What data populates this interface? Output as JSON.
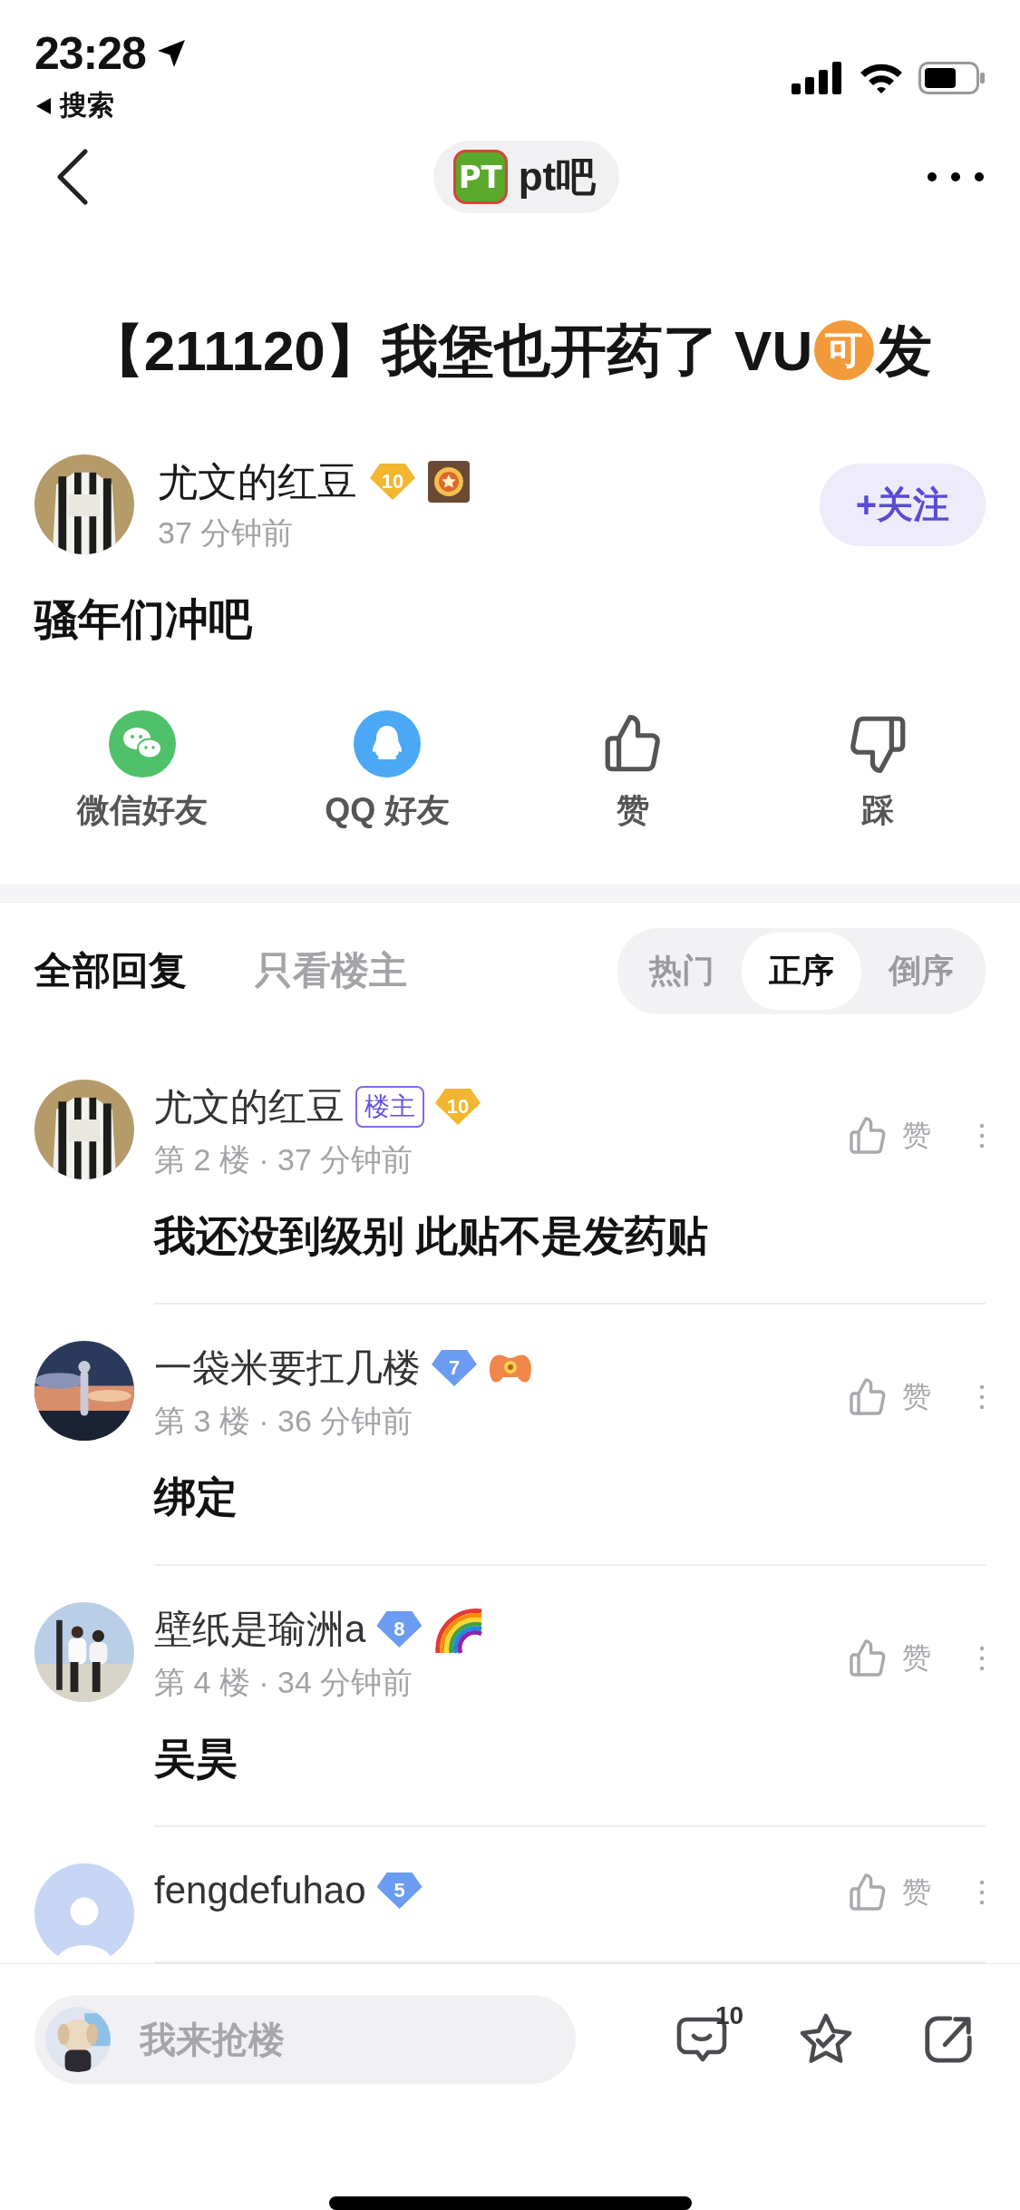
{
  "status_bar": {
    "time": "23:28",
    "back_label": "搜索"
  },
  "nav": {
    "logo_text": "PT",
    "forum": "pt吧"
  },
  "post": {
    "title": {
      "text": "【211120】我堡也开药了 VU",
      "emoji": "可",
      "after": "发"
    },
    "author": {
      "name": "尤文的红豆",
      "level": "10",
      "color": "#f2b630",
      "extra_badge": {
        "kind": "medal"
      },
      "time": "37 分钟前"
    },
    "follow_button": "+关注",
    "body": "骚年们冲吧",
    "share": [
      {
        "kind": "wechat",
        "label": "微信好友"
      },
      {
        "kind": "qq",
        "label": "QQ 好友"
      },
      {
        "kind": "like",
        "label": "赞"
      },
      {
        "kind": "dislike",
        "label": "踩"
      }
    ]
  },
  "reply_filters": [
    {
      "label": "全部回复",
      "selected": true
    },
    {
      "label": "只看楼主",
      "selected": false
    }
  ],
  "sort_tabs": [
    {
      "label": "热门",
      "selected": false
    },
    {
      "label": "正序",
      "selected": true
    },
    {
      "label": "倒序",
      "selected": false
    }
  ],
  "replies": [
    {
      "name": "尤文的红豆",
      "op_tag": "楼主",
      "level": "10",
      "color": "#f2b630",
      "meta": "第 2 楼 · 37 分钟前",
      "content": "我还没到级别 此贴不是发药贴",
      "like_label": "赞"
    },
    {
      "name": "一袋米要扛几楼",
      "level": "7",
      "color": "#6b9cf2",
      "extra_badge": {
        "kind": "gamepad"
      },
      "meta": "第 3 楼 · 36 分钟前",
      "content": "绑定",
      "like_label": "赞"
    },
    {
      "name": "壁纸是瑜洲a",
      "level": "8",
      "color": "#6b9cf2",
      "extra_badge": {
        "kind": "rainbow"
      },
      "meta": "第 4 楼 · 34 分钟前",
      "content": "吴昊",
      "like_label": "赞"
    },
    {
      "avatar": {
        "kind": "default"
      },
      "name": "fengdefuhao",
      "level": "5",
      "color": "#6b9cf2",
      "like_label": "赞"
    }
  ],
  "composer": {
    "placeholder": "我来抢楼",
    "comment_count": "10"
  }
}
